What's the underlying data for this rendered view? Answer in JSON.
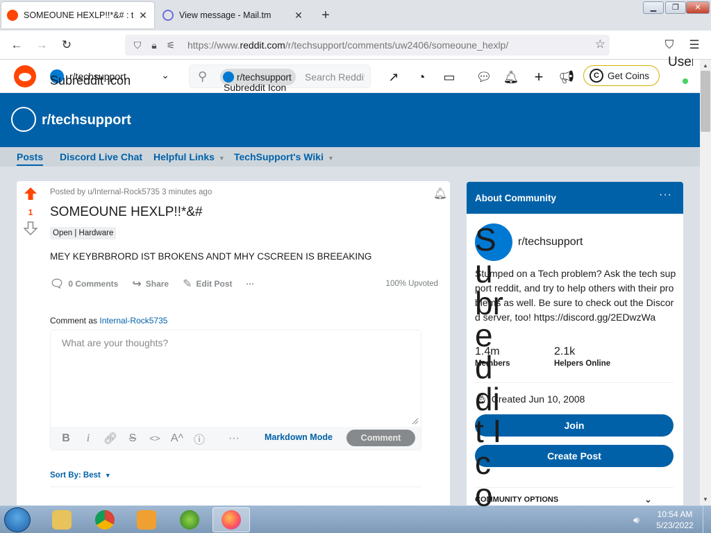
{
  "browser": {
    "tabs": [
      {
        "title": "SOMEOUNE HEXLP!!*&# : techsupport",
        "active": true
      },
      {
        "title": "View message - Mail.tm",
        "active": false
      }
    ],
    "url_dim_prefix": "https://www.",
    "url_domain": "reddit.com",
    "url_path": "/r/techsupport/comments/uw2406/someoune_hexlp/",
    "window_controls": [
      "minimize",
      "restore",
      "close"
    ]
  },
  "reddit_header": {
    "subreddit": "r/techsupport",
    "subreddit_icon_alt": "Subreddit Icon",
    "search_chip": "r/techsupport",
    "search_chip_icon_alt": "Subreddit Icon",
    "search_placeholder": "Search Reddit",
    "get_coins": "Get Coins",
    "user_avatar_alt": "User avatar"
  },
  "banner": {
    "name": "r/techsupport",
    "color": "#0061a8"
  },
  "subnav": {
    "items": [
      "Posts",
      "Discord Live Chat",
      "Helpful Links",
      "TechSupport's Wiki"
    ]
  },
  "post": {
    "votes": "1",
    "meta": "Posted by u/Internal-Rock5735 3 minutes ago",
    "title": "SOMEOUNE HEXLP!!*&#",
    "flair": "Open | Hardware",
    "body": "MEY KEYBRBRORD IST BROKENS ANDT MHY CSCREEN IS BREEAKING",
    "actions": {
      "comments": "0 Comments",
      "share": "Share",
      "edit": "Edit Post",
      "more": "···"
    },
    "upvoted": "100% Upvoted",
    "comment_as_label": "Comment as",
    "comment_as_user": "Internal-Rock5735",
    "comment_placeholder": "What are your thoughts?",
    "markdown_mode": "Markdown Mode",
    "comment_button": "Comment",
    "sort_by": "Sort By: Best"
  },
  "sidebar": {
    "header": "About Community",
    "more": "···",
    "name": "r/techsupport",
    "icon_alt": "Subreddit Icon",
    "description": "Stumped on a Tech problem? Ask the tech support reddit, and try to help others with their problems as well. Be sure to check out the Discord server, too! https://discord.gg/2EDwzWa",
    "members_value": "1.4m",
    "members_label": "Members",
    "online_value": "2.1k",
    "online_label": "Helpers Online",
    "created": "Created Jun 10, 2008",
    "join": "Join",
    "create_post": "Create Post",
    "community_options": "COMMUNITY OPTIONS"
  },
  "taskbar": {
    "time": "10:54 AM",
    "date": "5/23/2022",
    "apps": [
      "file-explorer",
      "chrome",
      "media-player",
      "windows-media-center",
      "firefox"
    ]
  },
  "colors": {
    "reddit_orange": "#ff4500",
    "brand_blue": "#0061a8",
    "page_bg": "#dae0e6"
  }
}
